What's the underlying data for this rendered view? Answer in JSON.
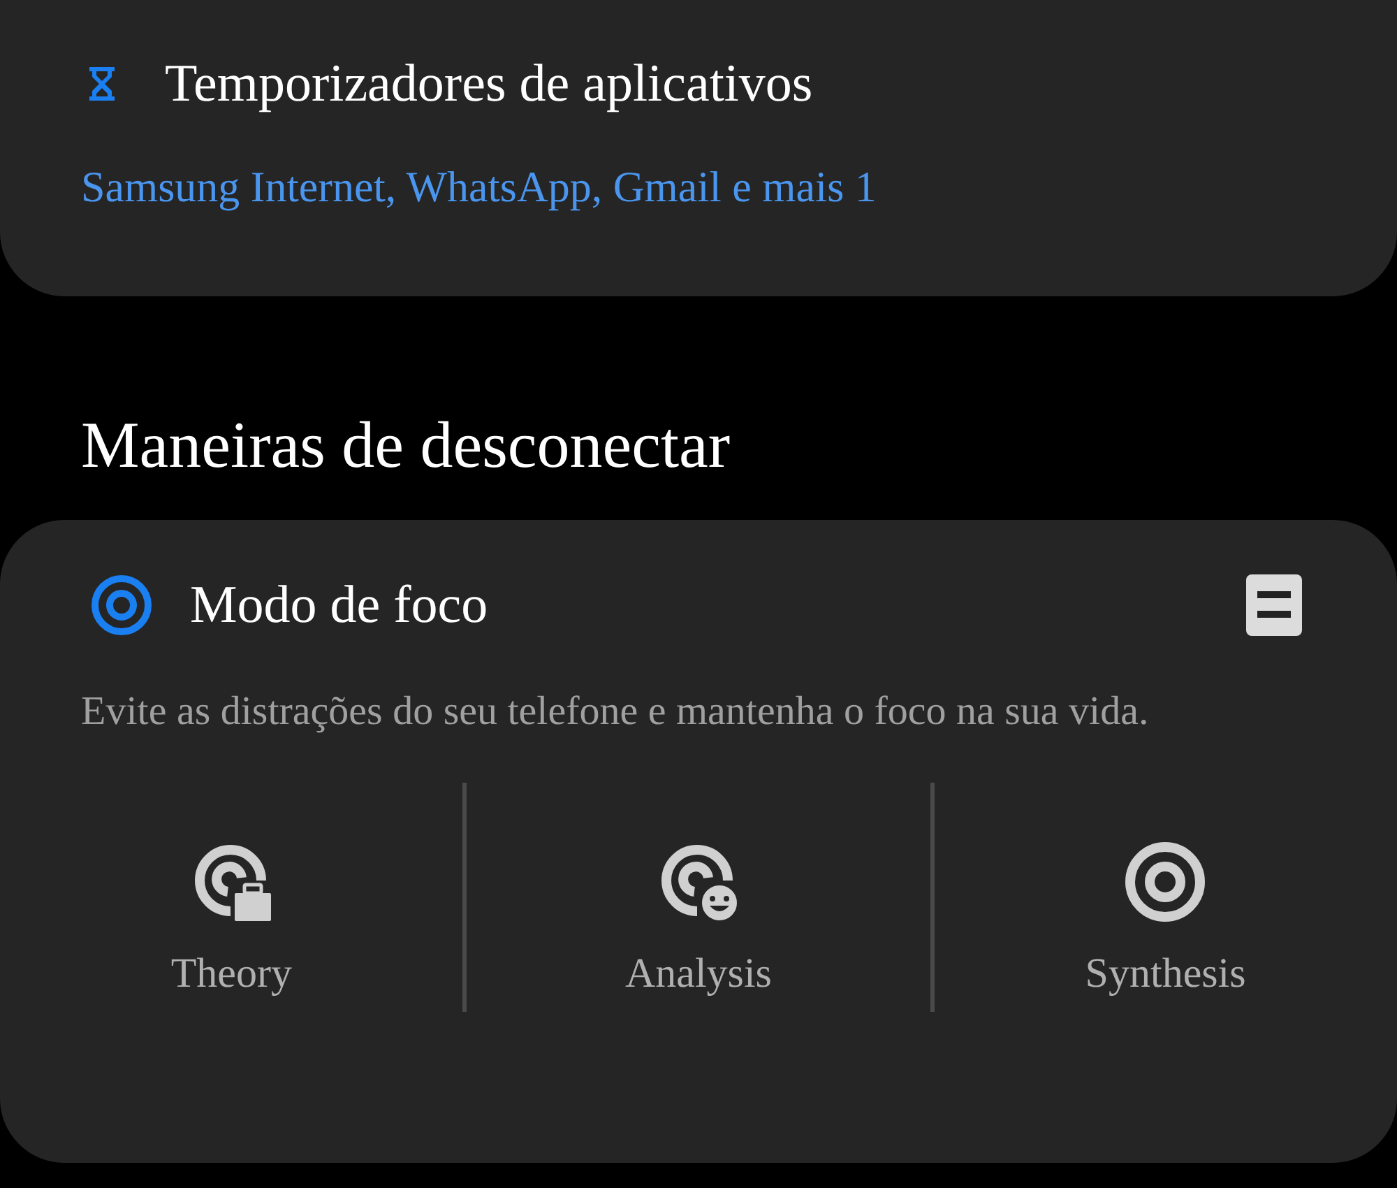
{
  "app_timers": {
    "title": "Temporizadores de aplicativos",
    "apps": "Samsung Internet, WhatsApp, Gmail e mais 1"
  },
  "section_title": "Maneiras de desconectar",
  "focus_mode": {
    "title": "Modo de foco",
    "description": "Evite as distrações do seu telefone e mantenha o foco na sua vida.",
    "modes": [
      {
        "kind": "work",
        "label": "Theory"
      },
      {
        "kind": "personal",
        "label": "Analysis"
      },
      {
        "kind": "plain",
        "label": "Synthesis"
      }
    ]
  }
}
